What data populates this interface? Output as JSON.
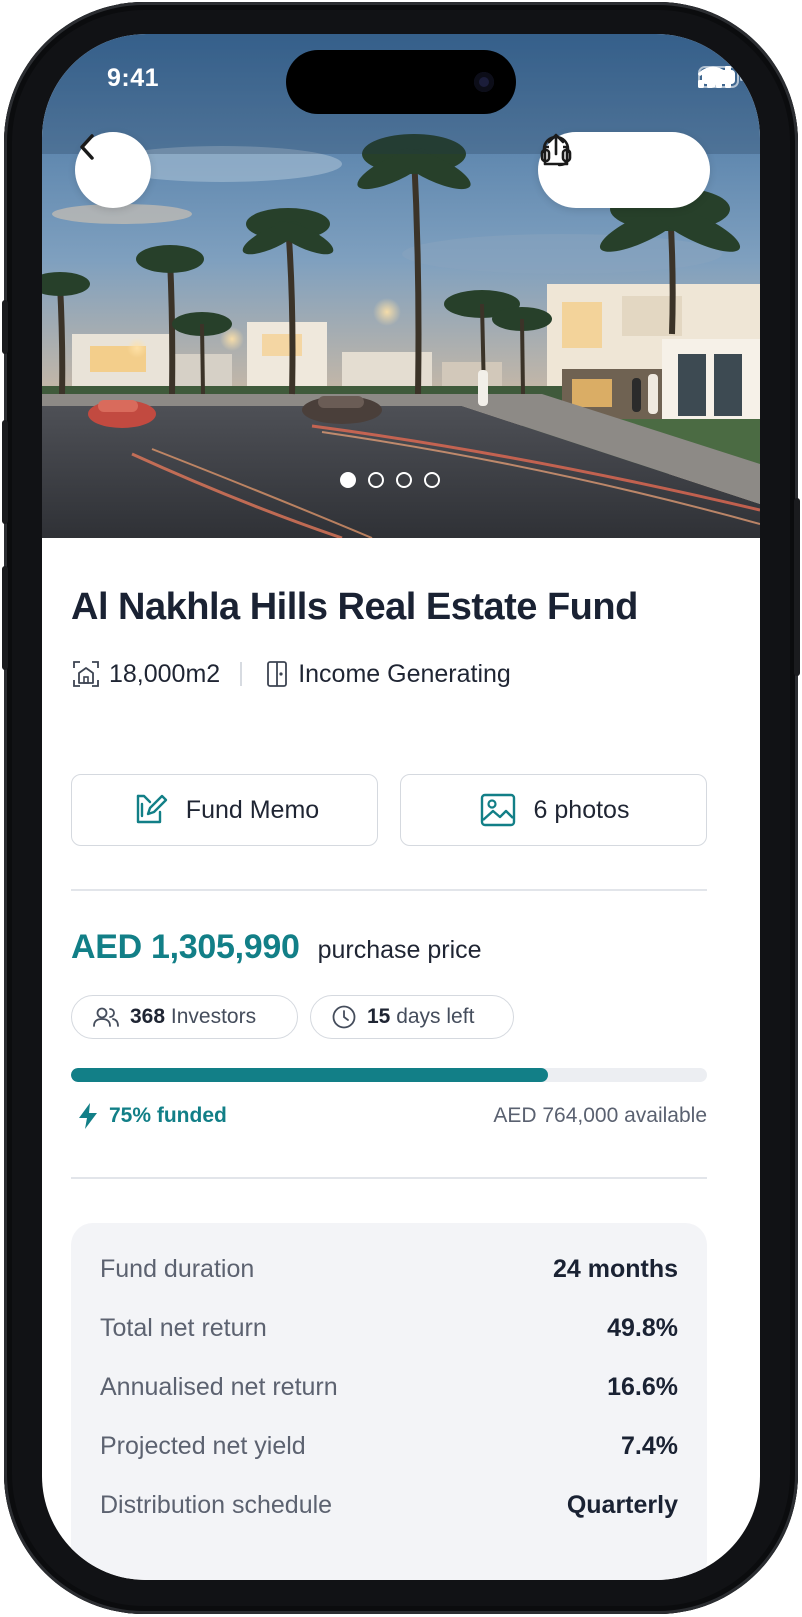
{
  "status_bar": {
    "time": "9:41"
  },
  "hero": {
    "carousel_total": 4,
    "carousel_active": 0,
    "icons": [
      "back-arrow-icon",
      "headset-support-icon",
      "share-icon"
    ]
  },
  "fund": {
    "title": "Al Nakhla Hills Real Estate Fund",
    "area": "18,000m2",
    "category": "Income Generating",
    "memo_label": "Fund Memo",
    "photos_label": "6 photos",
    "price": "AED 1,305,990",
    "price_label": "purchase price",
    "investors_count": "368",
    "investors_label": "Investors",
    "days_count": "15",
    "days_label": "days left",
    "funded_fraction": 0.75,
    "funded_label": "75% funded",
    "available": "AED 764,000 available"
  },
  "stats": [
    {
      "label": "Fund duration",
      "value": "24 months"
    },
    {
      "label": "Total net return",
      "value": "49.8%"
    },
    {
      "label": "Annualised net return",
      "value": "16.6%"
    },
    {
      "label": "Projected net yield",
      "value": "7.4%"
    },
    {
      "label": "Distribution schedule",
      "value": "Quarterly"
    }
  ],
  "colors": {
    "accent": "#127f87",
    "text": "#1a2233",
    "muted": "#5c6270",
    "card": "#f3f4f7"
  }
}
